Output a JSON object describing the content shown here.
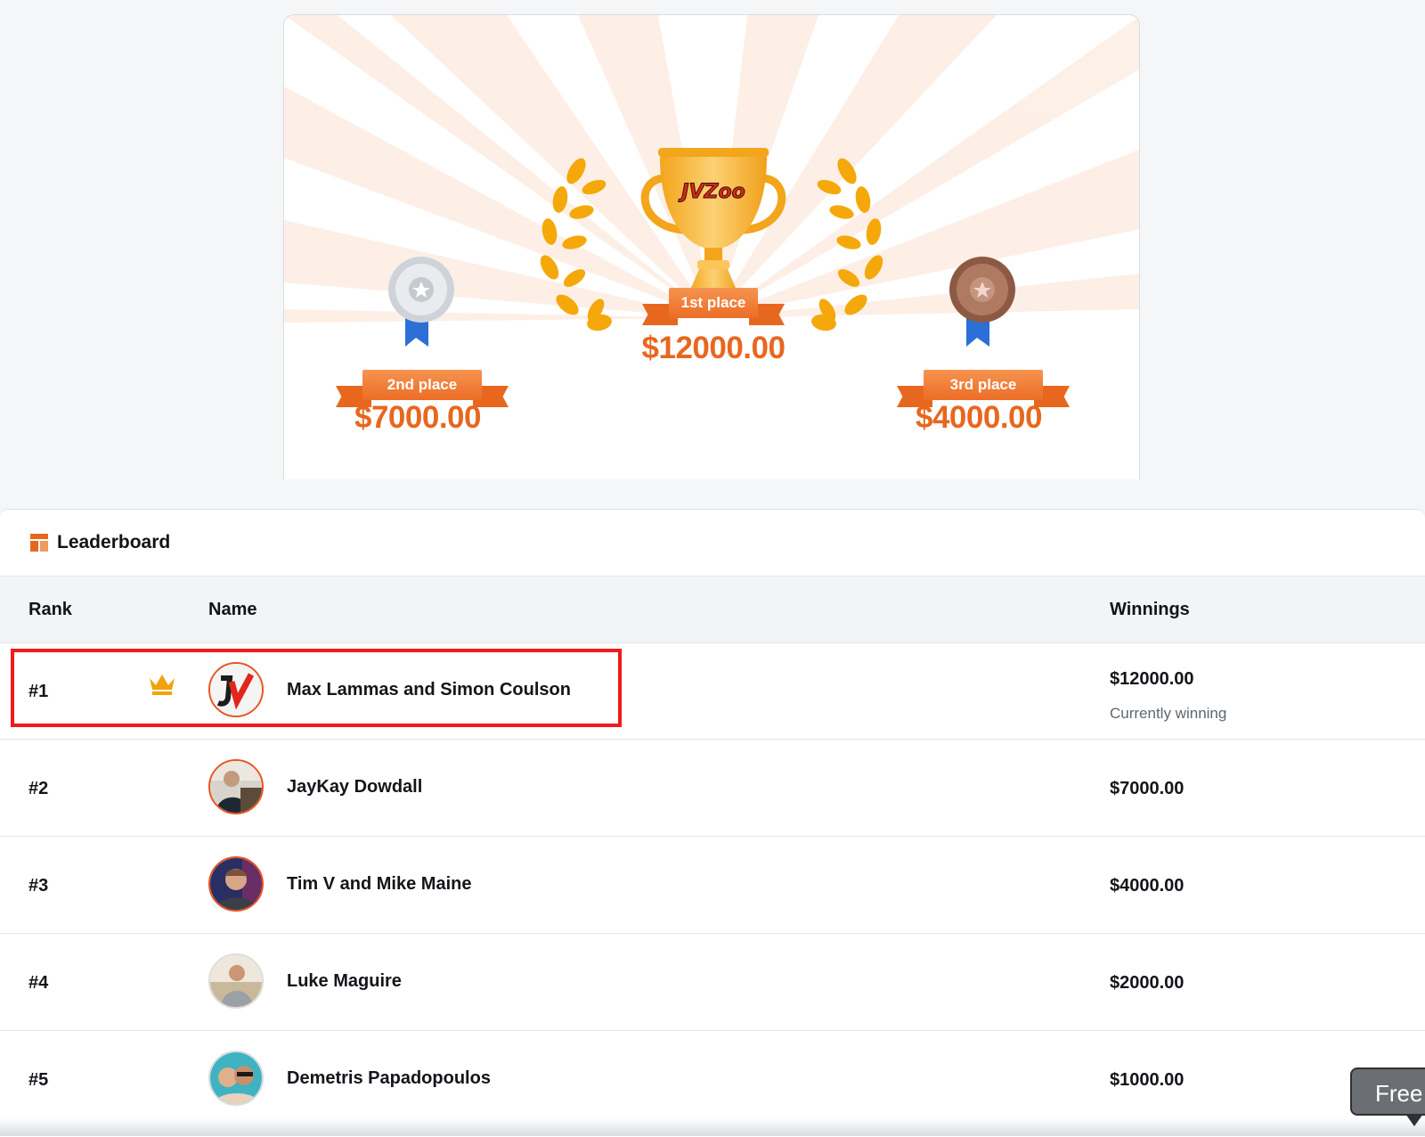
{
  "prizes": {
    "first": {
      "label": "1st place",
      "amount": "$12000.00"
    },
    "second": {
      "label": "2nd place",
      "amount": "$7000.00"
    },
    "third": {
      "label": "3rd place",
      "amount": "$4000.00"
    },
    "trophy_logo_text": "JVZoo"
  },
  "leaderboard": {
    "title": "Leaderboard",
    "title_icon": "leaderboard-icon",
    "columns": {
      "rank": "Rank",
      "name": "Name",
      "winnings": "Winnings"
    },
    "rows": [
      {
        "rank": "#1",
        "name": "Max Lammas and Simon Coulson",
        "winnings": "$12000.00",
        "status": "Currently winning",
        "crown": true,
        "avatar": "jvzoo-logo-avatar"
      },
      {
        "rank": "#2",
        "name": "JayKay Dowdall",
        "winnings": "$7000.00",
        "avatar": "user-photo-avatar"
      },
      {
        "rank": "#3",
        "name": "Tim V and Mike Maine",
        "winnings": "$4000.00",
        "avatar": "user-photo-avatar"
      },
      {
        "rank": "#4",
        "name": "Luke Maguire",
        "winnings": "$2000.00",
        "avatar": "user-photo-avatar"
      },
      {
        "rank": "#5",
        "name": "Demetris Papadopoulos",
        "winnings": "$1000.00",
        "avatar": "user-photo-avatar"
      }
    ]
  },
  "floating_tab": {
    "label": "Free"
  },
  "colors": {
    "accent_orange": "#e8671f",
    "highlight_red": "#ef1b1b",
    "crown_gold": "#f0a30a",
    "ribbon_blue": "#2c6fd6"
  }
}
